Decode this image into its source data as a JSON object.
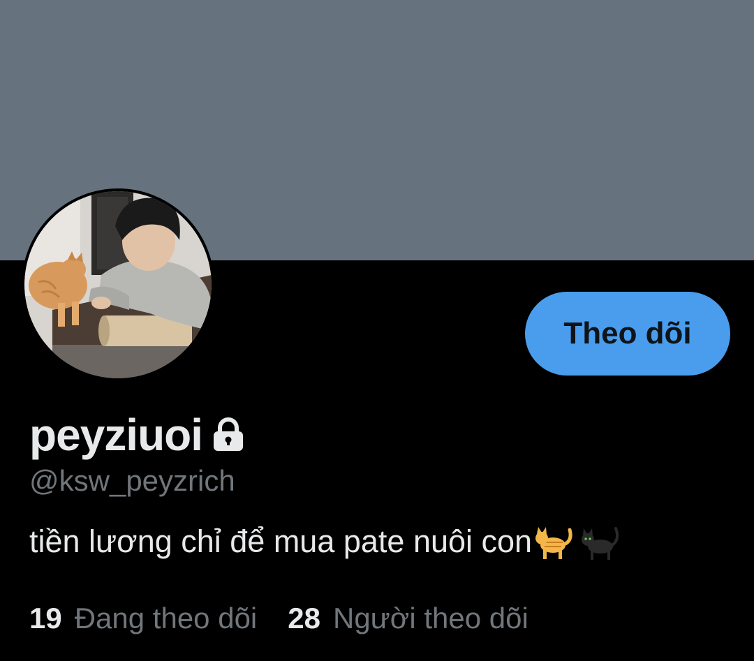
{
  "profile": {
    "display_name": "peyziuoi",
    "handle": "@ksw_peyzrich",
    "bio": "tiền lương chỉ để mua pate nuôi con",
    "bio_emojis": [
      "orange-cat-emoji",
      "black-cat-emoji"
    ],
    "protected_icon": "lock-icon",
    "avatar": "profile-photo"
  },
  "actions": {
    "follow_label": "Theo dõi"
  },
  "stats": {
    "following_count": "19",
    "following_label": "Đang theo dõi",
    "followers_count": "28",
    "followers_label": "Người theo dõi"
  },
  "colors": {
    "banner": "#66737f",
    "background": "#000000",
    "follow_button": "#4a9ded",
    "primary_text": "#e7e9ea",
    "secondary_text": "#71767b"
  }
}
